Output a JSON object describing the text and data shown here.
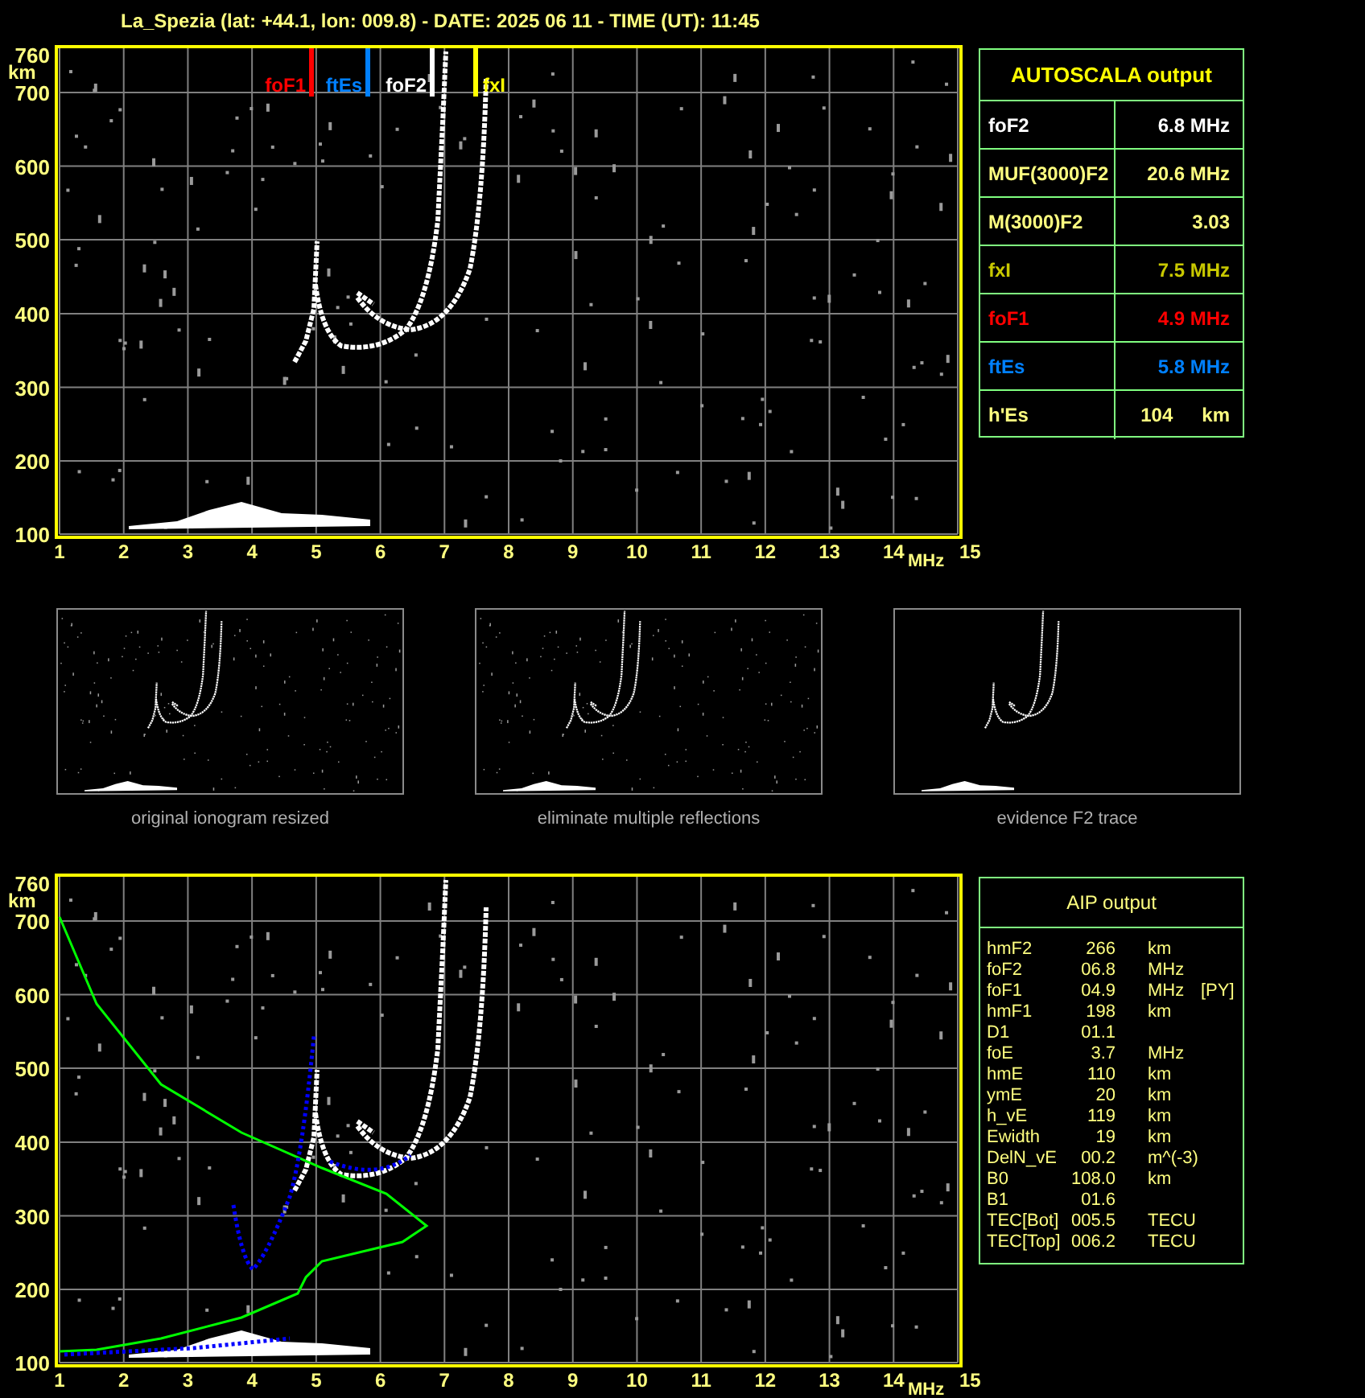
{
  "title": "La_Spezia (lat: +44.1, lon: 009.8) - DATE: 2025 06 11 - TIME (UT): 11:45",
  "top_chart": {
    "y_ticks": [
      "760",
      "700",
      "600",
      "500",
      "400",
      "300",
      "200",
      "100"
    ],
    "y_unit": "km",
    "x_ticks": [
      "1",
      "2",
      "3",
      "4",
      "5",
      "6",
      "7",
      "8",
      "9",
      "10",
      "11",
      "12",
      "13",
      "14",
      "15"
    ],
    "x_unit": "MHz",
    "markers": [
      {
        "label": "foF1",
        "color": "#ff0000"
      },
      {
        "label": "ftEs",
        "color": "#0080ff"
      },
      {
        "label": "foF2",
        "color": "#ffffff"
      },
      {
        "label": "fxI",
        "color": "#ffff00"
      }
    ]
  },
  "autoscala": {
    "title": "AUTOSCALA output",
    "rows": [
      {
        "label": "foF2",
        "value": "6.8 MHz",
        "color": "#ffffff"
      },
      {
        "label": "MUF(3000)F2",
        "value": "20.6 MHz",
        "color": "#ffff80"
      },
      {
        "label": "M(3000)F2",
        "value": "3.03",
        "color": "#ffff80"
      },
      {
        "label": "fxI",
        "value": "7.5 MHz",
        "color": "#c8c800"
      },
      {
        "label": "foF1",
        "value": "4.9 MHz",
        "color": "#ff0000"
      },
      {
        "label": "ftEs",
        "value": "5.8 MHz",
        "color": "#0080ff"
      },
      {
        "label": "h'Es",
        "value": "104",
        "unit": "km",
        "color": "#ffff80"
      }
    ]
  },
  "thumbnails": [
    {
      "caption": "original ionogram resized"
    },
    {
      "caption": "eliminate multiple reflections"
    },
    {
      "caption": "evidence F2 trace"
    }
  ],
  "bottom_chart": {
    "y_ticks": [
      "760",
      "700",
      "600",
      "500",
      "400",
      "300",
      "200",
      "100"
    ],
    "y_unit": "km",
    "x_ticks": [
      "1",
      "2",
      "3",
      "4",
      "5",
      "6",
      "7",
      "8",
      "9",
      "10",
      "11",
      "12",
      "13",
      "14",
      "15"
    ],
    "x_unit": "MHz"
  },
  "aip": {
    "title": "AIP output",
    "rows": [
      {
        "name": "hmF2",
        "value": "266",
        "unit": "km"
      },
      {
        "name": "foF2",
        "value": "06.8",
        "unit": "MHz"
      },
      {
        "name": "foF1",
        "value": "04.9",
        "unit": "MHz",
        "flag": "[PY]"
      },
      {
        "name": "hmF1",
        "value": "198",
        "unit": "km"
      },
      {
        "name": "D1",
        "value": "01.1"
      },
      {
        "name": "foE",
        "value": "3.7",
        "unit": "MHz"
      },
      {
        "name": "hmE",
        "value": "110",
        "unit": "km"
      },
      {
        "name": "ymE",
        "value": "20",
        "unit": "km"
      },
      {
        "name": "h_vE",
        "value": "119",
        "unit": "km"
      },
      {
        "name": "Ewidth",
        "value": "19",
        "unit": "km"
      },
      {
        "name": "DelN_vE",
        "value": "00.2",
        "unit": "m^(-3)"
      },
      {
        "name": "B0",
        "value": "108.0",
        "unit": "km"
      },
      {
        "name": "B1",
        "value": "01.6"
      },
      {
        "name": "TEC[Bot]",
        "value": "005.5",
        "unit": "TECU"
      },
      {
        "name": "TEC[Top]",
        "value": "006.2",
        "unit": "TECU"
      }
    ]
  }
}
